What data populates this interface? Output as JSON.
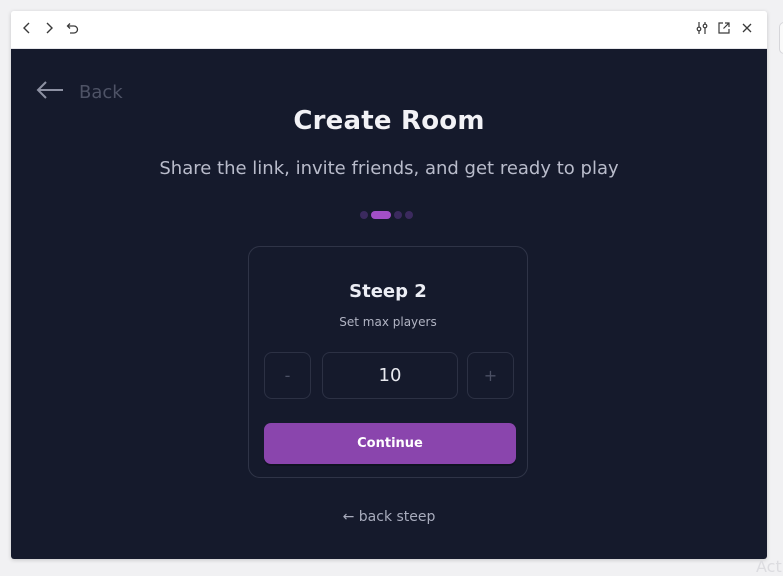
{
  "toolbar": {
    "icons": [
      "chevron-left-icon",
      "chevron-right-icon",
      "reload-icon",
      "sliders-icon",
      "open-external-icon",
      "close-icon"
    ]
  },
  "app": {
    "back_label": "Back",
    "title": "Create Room",
    "subtitle": "Share the link, invite friends, and get ready to play",
    "progress": {
      "total": 4,
      "current": 2
    },
    "card": {
      "step_title": "Steep 2",
      "step_desc": "Set max players",
      "decrement": "-",
      "value": "10",
      "increment": "+",
      "continue_label": "Continue"
    },
    "back_step_label": "← back steep"
  },
  "colors": {
    "background": "#151a2c",
    "accent": "#8a45ad",
    "active_dot": "#a24fc6"
  },
  "watermark": "Act"
}
